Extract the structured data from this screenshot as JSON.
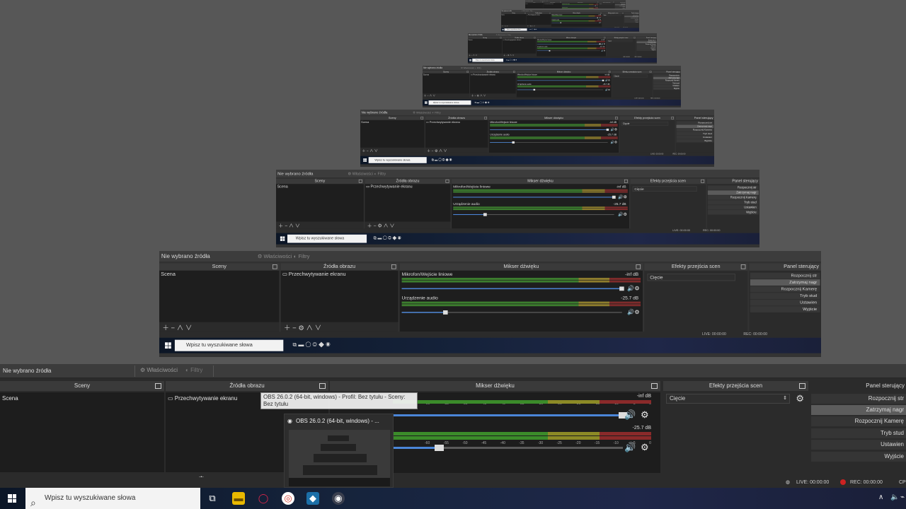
{
  "window": {
    "title": "OBS 26.0.2 (64-bit, windows) - Profil: Bez tytułu - Sceny: Bez tytułu"
  },
  "source_bar": {
    "no_source": "Nie wybrano źródła",
    "properties": "Właściwości",
    "filters": "Filtry"
  },
  "docks": {
    "scenes": {
      "title": "Sceny",
      "items": [
        "Scena"
      ]
    },
    "sources": {
      "title": "Źródła obrazu",
      "items": [
        "Przechwytywanie ekranu"
      ]
    },
    "mixer": {
      "title": "Mikser dźwięku",
      "ticks": [
        "-60",
        "-55",
        "-50",
        "-45",
        "-40",
        "-35",
        "-30",
        "-25",
        "-20",
        "-15",
        "-10",
        "-5",
        "0"
      ],
      "channels": [
        {
          "name": "Mikrofon/Wejście liniowe",
          "db": "-inf dB",
          "volume": 1.0
        },
        {
          "name": "Urządzenie audio",
          "db": "-25.7 dB",
          "volume": 0.2
        }
      ]
    },
    "transitions": {
      "title": "Efekty przejścia scen",
      "selected": "Cięcie"
    },
    "controls": {
      "title": "Panel sterujący",
      "buttons": [
        "Rozpocznij strumień",
        "Zatrzymaj nagrywanie",
        "Rozpocznij Kamerę Wirtualną",
        "Tryb studia",
        "Ustawienia",
        "Wyjście"
      ],
      "buttons_visible": [
        "Rozpocznij str",
        "Zatrzymaj nagr",
        "Rozpocznij Kamerę",
        "Tryb stud",
        "Ustawien",
        "Wyjście"
      ]
    }
  },
  "status": {
    "live": "LIVE: 00:00:00",
    "rec": "REC: 00:00:00",
    "cpu": "CP"
  },
  "tooltip": {
    "text": "OBS 26.0.2 (64-bit, windows) - Profil: Bez tytułu - Sceny: Bez tytułu"
  },
  "thumbnail": {
    "title": "OBS 26.0.2 (64-bit, windows) - ..."
  },
  "taskbar": {
    "search_placeholder": "Wpisz tu wyszukiwane słowa"
  },
  "colors": {
    "accent_blue": "#4b86d8",
    "meter_green": "#3b8b2a",
    "meter_yellow": "#8c8a26",
    "meter_red": "#8a2a2a",
    "rec_red": "#cc2222"
  },
  "icons": {
    "windows": "windows-icon",
    "search": "search-icon",
    "settings": "gear-icon",
    "speaker": "speaker-icon"
  }
}
